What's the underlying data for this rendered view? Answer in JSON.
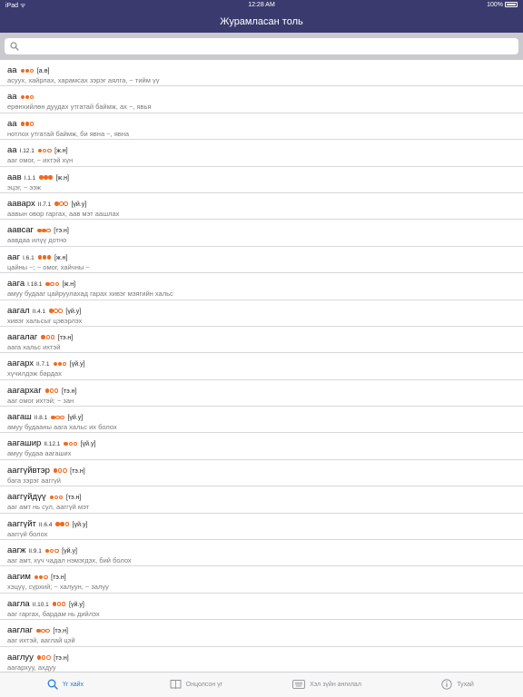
{
  "status_bar": {
    "left": "iPad ᯤ",
    "time": "12:28 AM",
    "battery": "100%"
  },
  "nav": {
    "title": "Журамласан толь"
  },
  "search": {
    "placeholder": "",
    "value": ""
  },
  "colors": {
    "accent": "#ef6b21",
    "nav_bg": "#3b3a6e",
    "tab_active": "#2a7bd8"
  },
  "entries": [
    {
      "word": "аа",
      "code": "",
      "dots": [
        1,
        1,
        0
      ],
      "pos": "[а.ө]",
      "def": "асуух, хайрлах, харамсах зэрэг аялга, ~ тийм үү"
    },
    {
      "word": "аа",
      "code": "",
      "dots": [
        1,
        1,
        0
      ],
      "pos": "",
      "def": "ерөнхийлөн дуудах утгатай баймж, ах ~, явья"
    },
    {
      "word": "аа",
      "code": "",
      "dots": [
        1,
        1,
        0
      ],
      "pos": "",
      "def": "нотлох утгатай баймж, би явна ~, явна"
    },
    {
      "word": "аа",
      "code": "I.12.1",
      "dots": [
        1,
        0,
        0
      ],
      "pos": "[ж.н]",
      "def": "ааг омог, ~ ихтэй хүн"
    },
    {
      "word": "аав",
      "code": "I.1.1",
      "dots": [
        1,
        1,
        1
      ],
      "pos": "[ж.н]",
      "def": "эцэг, ~ ээж"
    },
    {
      "word": "ааварх",
      "code": "II.7.1",
      "dots": [
        1,
        0,
        0
      ],
      "pos": "[үй.у]",
      "def": "аавын овор гаргах, аав мэт аашлах"
    },
    {
      "word": "аавсаг",
      "code": "",
      "dots": [
        1,
        1,
        0
      ],
      "pos": "[тэ.н]",
      "def": "аавдаа илүү дотно"
    },
    {
      "word": "ааг",
      "code": "I.6.1",
      "dots": [
        1,
        1,
        1
      ],
      "pos": "[ж.н]",
      "def": "цайны ~; ~ омог, хайчны ~"
    },
    {
      "word": "аага",
      "code": "I.18.1",
      "dots": [
        1,
        0,
        0
      ],
      "pos": "[ж.н]",
      "def": "амуу будааг цайруулахад гарах хивэг мэягийн хальс"
    },
    {
      "word": "аагал",
      "code": "II.4.1",
      "dots": [
        1,
        0,
        0
      ],
      "pos": "[үй.у]",
      "def": "хивэг хальсыг цэвэрлэх"
    },
    {
      "word": "аагалаг",
      "code": "",
      "dots": [
        1,
        0,
        0
      ],
      "pos": "[тэ.н]",
      "def": "аага хальс ихтэй"
    },
    {
      "word": "аагарх",
      "code": "II.7.1",
      "dots": [
        1,
        1,
        0
      ],
      "pos": "[үй.у]",
      "def": "хүчилдэж бардах"
    },
    {
      "word": "аагархаг",
      "code": "",
      "dots": [
        1,
        0,
        0
      ],
      "pos": "[тэ.н]",
      "def": "ааг омог ихтэй; ~ зан"
    },
    {
      "word": "аагаш",
      "code": "II.8.1",
      "dots": [
        1,
        0,
        0
      ],
      "pos": "[үй.у]",
      "def": "амуу будааны аага хальс их болох"
    },
    {
      "word": "аагашир",
      "code": "II.12.1",
      "dots": [
        1,
        0,
        0
      ],
      "pos": "[үй.у]",
      "def": "амуу будаа аагаших"
    },
    {
      "word": "ааггүйвтэр",
      "code": "",
      "dots": [
        1,
        0,
        0
      ],
      "pos": "[тэ.н]",
      "def": "бага зэрэг ааггүй"
    },
    {
      "word": "ааггүйдүү",
      "code": "",
      "dots": [
        1,
        0,
        0
      ],
      "pos": "[тэ.н]",
      "def": "ааг амт нь сул, ааггүй мэт"
    },
    {
      "word": "ааггүйт",
      "code": "II.6.4",
      "dots": [
        1,
        1,
        0
      ],
      "pos": "[үй.у]",
      "def": "ааггүй болох"
    },
    {
      "word": "аагж",
      "code": "II.9.1",
      "dots": [
        1,
        0,
        0
      ],
      "pos": "[үй.у]",
      "def": "ааг амт, хүч чадал нэмэгдэх, бий болох"
    },
    {
      "word": "аагим",
      "code": "",
      "dots": [
        1,
        1,
        0
      ],
      "pos": "[тэ.н]",
      "def": "хэцүү, сүрхий; ~ халуун, ~ залуу"
    },
    {
      "word": "аагла",
      "code": "II.10.1",
      "dots": [
        1,
        0,
        0
      ],
      "pos": "[үй.у]",
      "def": "ааг гаргах, бардам нь дийлэх"
    },
    {
      "word": "ааглаг",
      "code": "",
      "dots": [
        1,
        0,
        0
      ],
      "pos": "[тэ.н]",
      "def": "ааг ихтэй, ааглай цэй"
    },
    {
      "word": "ааглуу",
      "code": "",
      "dots": [
        1,
        0,
        0
      ],
      "pos": "[тэ.н]",
      "def": "аагархуу, ахдуу"
    }
  ],
  "tabs": [
    {
      "label": "Үг хайх",
      "icon": "search-icon",
      "active": true
    },
    {
      "label": "Онцолсон үг",
      "icon": "book-icon",
      "active": false
    },
    {
      "label": "Хэл зүйн ангилал",
      "icon": "keyboard-icon",
      "active": false
    },
    {
      "label": "Тухай",
      "icon": "info-icon",
      "active": false
    }
  ]
}
